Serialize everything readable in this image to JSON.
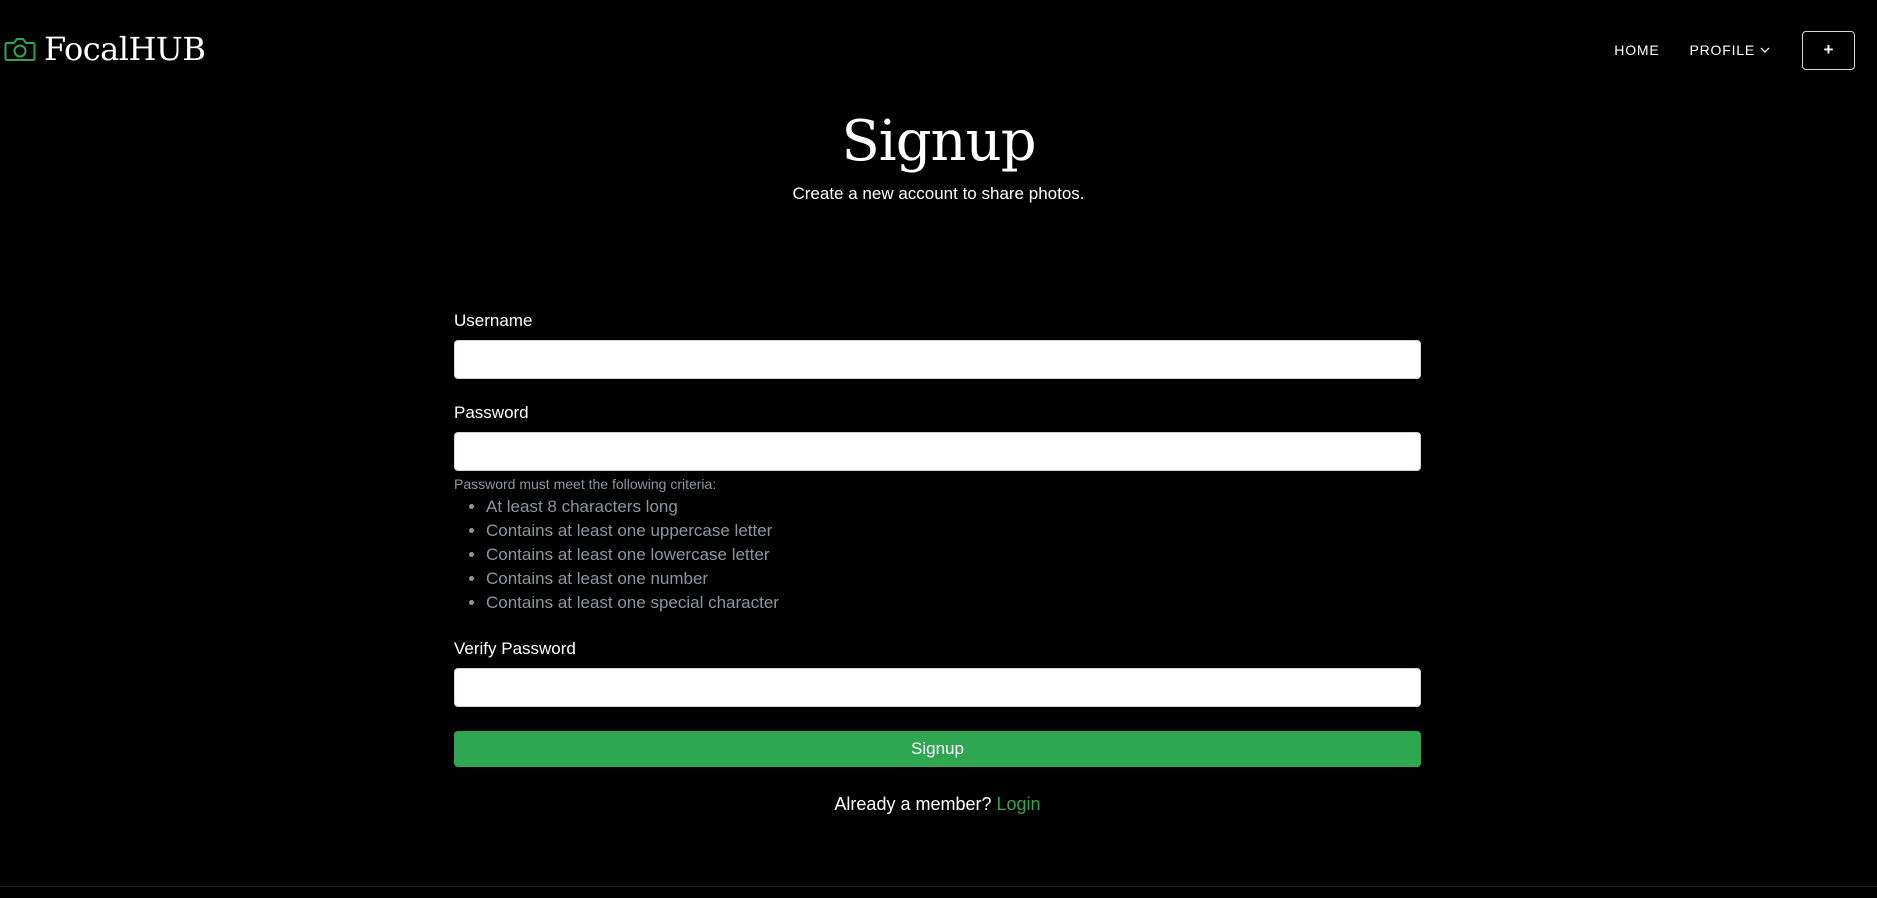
{
  "brand": {
    "name": "FocalHUB",
    "icon": "camera-icon",
    "accent_color": "#2fa650"
  },
  "nav": {
    "home_label": "HOME",
    "profile_label": "PROFILE",
    "add_label": "+"
  },
  "hero": {
    "title": "Signup",
    "subtitle": "Create a new account to share photos."
  },
  "form": {
    "username_label": "Username",
    "username_value": "",
    "password_label": "Password",
    "password_value": "",
    "password_help": "Password must meet the following criteria:",
    "criteria": [
      "At least 8 characters long",
      "Contains at least one uppercase letter",
      "Contains at least one lowercase letter",
      "Contains at least one number",
      "Contains at least one special character"
    ],
    "verify_label": "Verify Password",
    "verify_value": "",
    "submit_label": "Signup",
    "member_prompt": "Already a member?",
    "login_label": "Login"
  }
}
